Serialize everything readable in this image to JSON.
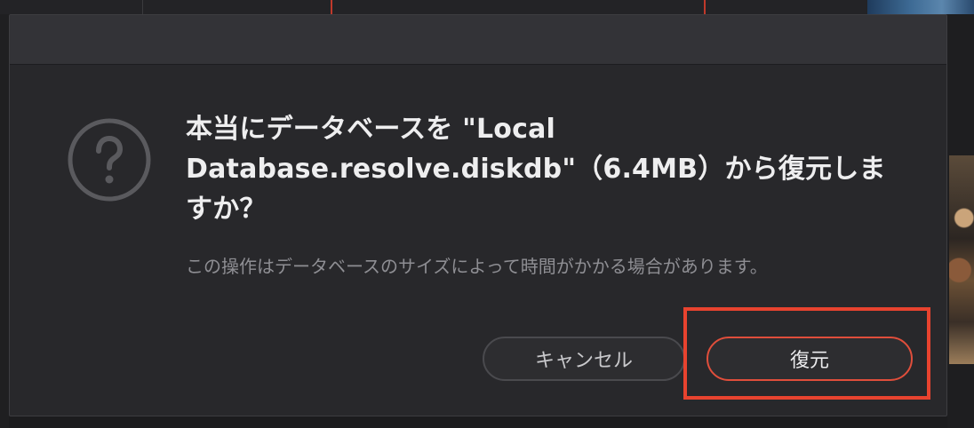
{
  "dialog": {
    "icon": "question-circle-icon",
    "message": "本当にデータベースを \"Local Database.resolve.diskdb\"（6.4MB）から復元しますか？",
    "message_line1": "本当にデータベースを \"Local",
    "message_line2": "Database.resolve.diskdb\"（6.4MB）から復元しますか？",
    "note": "この操作はデータベースのサイズによって時間がかかる場合があります。",
    "cancel_label": "キャンセル",
    "restore_label": "復元"
  },
  "colors": {
    "dialog_bg": "#28282b",
    "titlebar_bg": "#333337",
    "accent_border": "#e04e3b",
    "annotation_highlight": "#e8432f"
  }
}
